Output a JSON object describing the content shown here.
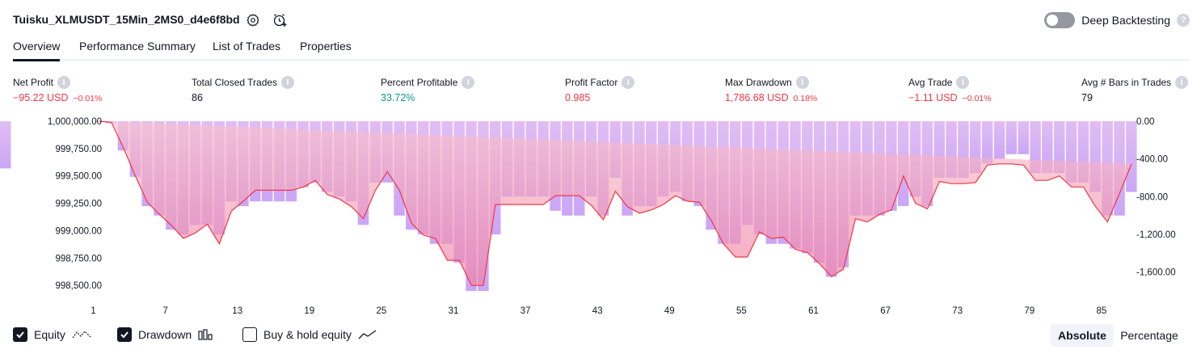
{
  "header": {
    "strategy_title": "Tuisku_XLMUSDT_15Min_2MS0_d4e6f8bd",
    "deep_backtesting_label": "Deep Backtesting",
    "help_glyph": "?"
  },
  "tabs": [
    {
      "label": "Overview",
      "active": true
    },
    {
      "label": "Performance Summary",
      "active": false
    },
    {
      "label": "List of Trades",
      "active": false
    },
    {
      "label": "Properties",
      "active": false
    }
  ],
  "metrics": [
    {
      "label": "Net Profit",
      "value": "−95.22 USD",
      "pct": "−0.01%",
      "color": "red"
    },
    {
      "label": "Total Closed Trades",
      "value": "86",
      "pct": "",
      "color": "dark"
    },
    {
      "label": "Percent Profitable",
      "value": "33.72%",
      "pct": "",
      "color": "green"
    },
    {
      "label": "Profit Factor",
      "value": "0.985",
      "pct": "",
      "color": "red"
    },
    {
      "label": "Max Drawdown",
      "value": "1,786.68 USD",
      "pct": "0.18%",
      "color": "red"
    },
    {
      "label": "Avg Trade",
      "value": "−1.11 USD",
      "pct": "−0.01%",
      "color": "red"
    },
    {
      "label": "Avg # Bars in Trades",
      "value": "79",
      "pct": "",
      "color": "dark"
    }
  ],
  "legend": {
    "equity_label": "Equity",
    "drawdown_label": "Drawdown",
    "buyhold_label": "Buy & hold equity",
    "equity_checked": true,
    "drawdown_checked": true,
    "buyhold_checked": false
  },
  "view_toggle": {
    "absolute_label": "Absolute",
    "percentage_label": "Percentage",
    "active": "Absolute"
  },
  "colors": {
    "equity_line": "#f23645",
    "equity_fill": "#fcc8cd",
    "drawdown_bar": "#d7b7f7",
    "negative": "#f23645",
    "positive": "#089981"
  },
  "chart_data": {
    "type": "area",
    "x_ticks": [
      "1",
      "7",
      "13",
      "19",
      "25",
      "31",
      "37",
      "43",
      "49",
      "55",
      "61",
      "67",
      "73",
      "79",
      "85"
    ],
    "left_axis_ticks": [
      "1,000,000.00",
      "999,750.00",
      "999,500.00",
      "999,250.00",
      "999,000.00",
      "998,750.00",
      "998,500.00"
    ],
    "right_axis_ticks": [
      "0.00",
      "-400.00",
      "-800.00",
      "-1,200.00",
      "-1,600.00"
    ],
    "ylim_equity": [
      998450,
      1000000
    ],
    "ylim_drawdown": [
      -1800,
      0
    ],
    "x": [
      1,
      2,
      3,
      4,
      5,
      6,
      7,
      8,
      9,
      10,
      11,
      12,
      13,
      14,
      15,
      16,
      17,
      18,
      19,
      20,
      21,
      22,
      23,
      24,
      25,
      26,
      27,
      28,
      29,
      30,
      31,
      32,
      33,
      34,
      35,
      36,
      37,
      38,
      39,
      40,
      41,
      42,
      43,
      44,
      45,
      46,
      47,
      48,
      49,
      50,
      51,
      52,
      53,
      54,
      55,
      56,
      57,
      58,
      59,
      60,
      61,
      62,
      63,
      64,
      65,
      66,
      67,
      68,
      69,
      70,
      71,
      72,
      73,
      74,
      75,
      76,
      77,
      78,
      79,
      80,
      81,
      82,
      83,
      84,
      85,
      86,
      87
    ],
    "series": [
      {
        "name": "Equity",
        "values": [
          1000000,
          999990,
          999760,
          999500,
          999260,
          999150,
          999050,
          998930,
          998980,
          999060,
          998880,
          999180,
          999270,
          999370,
          999370,
          999370,
          999370,
          999400,
          999460,
          999330,
          999290,
          999220,
          999110,
          999370,
          999540,
          999370,
          999070,
          998960,
          998930,
          998730,
          998730,
          998500,
          998500,
          999240,
          999240,
          999240,
          999240,
          999240,
          999320,
          999320,
          999320,
          999230,
          999100,
          999360,
          999220,
          999160,
          999190,
          999240,
          999320,
          999270,
          999260,
          999090,
          998880,
          998760,
          998760,
          998990,
          998930,
          998940,
          998830,
          998800,
          998700,
          998580,
          998650,
          999110,
          999080,
          999150,
          999190,
          999500,
          999250,
          999200,
          999450,
          999430,
          999430,
          999440,
          999600,
          999610,
          999610,
          999600,
          999460,
          999460,
          999500,
          999400,
          999400,
          999220,
          999080,
          999340,
          999610,
          999700
        ]
      },
      {
        "name": "Drawdown",
        "values": [
          0,
          -20,
          -310,
          -590,
          -900,
          -1000,
          -1150,
          -1200,
          -1100,
          -1100,
          -1200,
          -850,
          -900,
          -850,
          -850,
          -850,
          -850,
          -700,
          -650,
          -750,
          -800,
          -850,
          -1100,
          -650,
          -650,
          -1000,
          -1150,
          -1200,
          -1300,
          -1300,
          -1500,
          -1800,
          -1800,
          -1200,
          -800,
          -800,
          -800,
          -800,
          -950,
          -1000,
          -1000,
          -800,
          -1000,
          -600,
          -1000,
          -900,
          -900,
          -800,
          -750,
          -850,
          -900,
          -1150,
          -1300,
          -1300,
          -1100,
          -1200,
          -1300,
          -1300,
          -1350,
          -1400,
          -1500,
          -1650,
          -1550,
          -1000,
          -1000,
          -1000,
          -950,
          -900,
          -800,
          -900,
          -600,
          -600,
          -600,
          -550,
          -450,
          -400,
          -350,
          -350,
          -550,
          -550,
          -550,
          -650,
          -650,
          -750,
          -1000,
          -1000,
          -750,
          -500,
          -500
        ]
      }
    ]
  }
}
